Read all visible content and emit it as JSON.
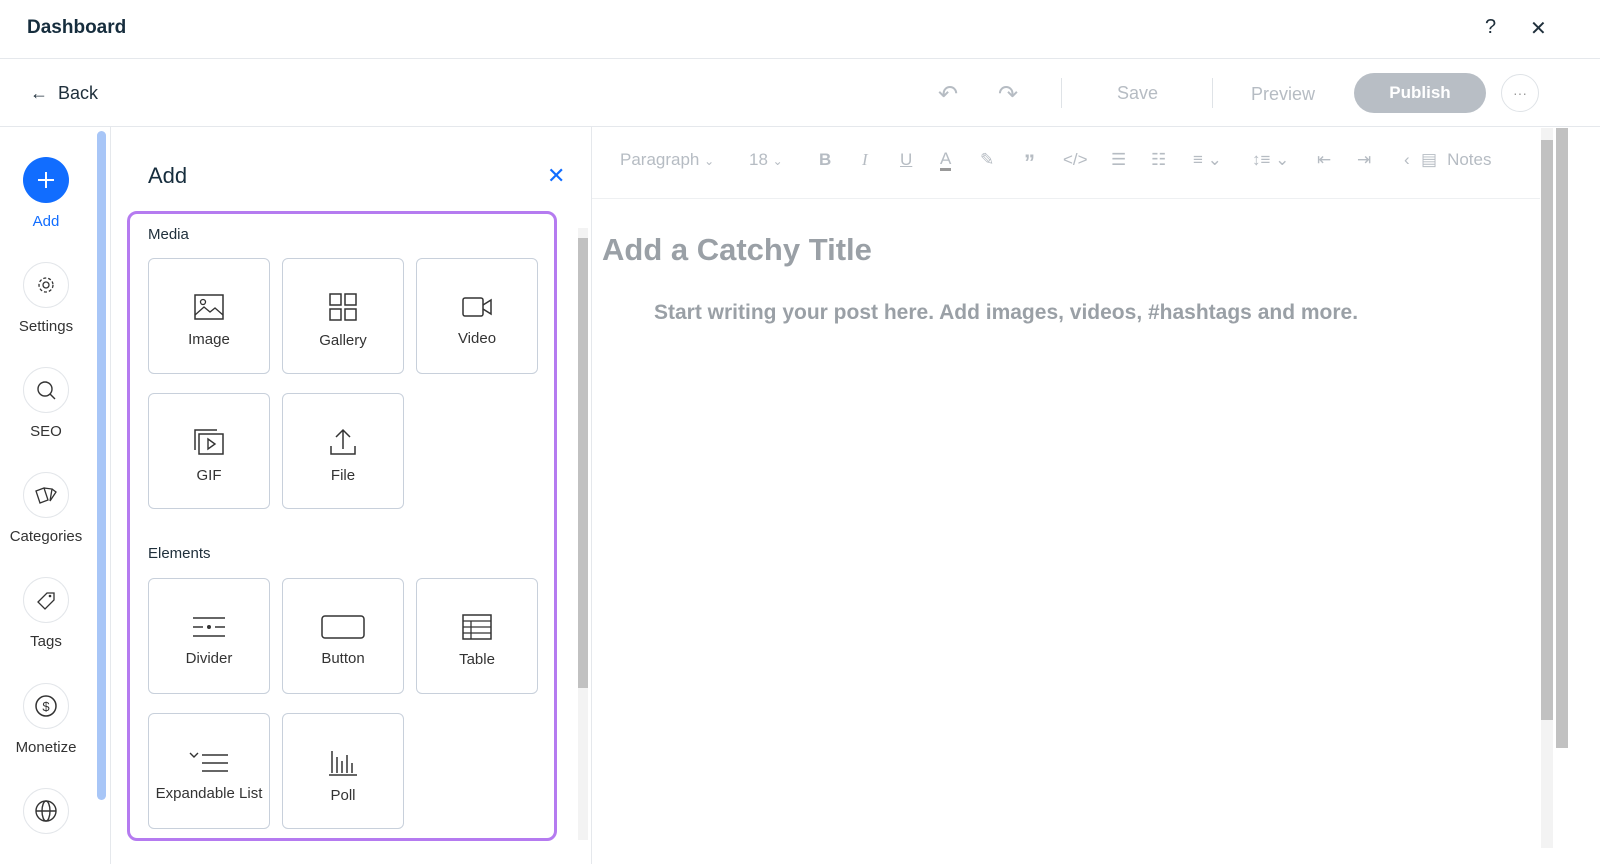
{
  "header": {
    "title": "Dashboard",
    "help": "?",
    "close": "✕"
  },
  "nav": {
    "back": "Back",
    "save": "Save",
    "preview": "Preview",
    "publish": "Publish",
    "more": "···"
  },
  "sidebar": {
    "items": [
      {
        "label": "Add",
        "icon": "plus-icon"
      },
      {
        "label": "Settings",
        "icon": "gear-icon"
      },
      {
        "label": "SEO",
        "icon": "search-icon"
      },
      {
        "label": "Categories",
        "icon": "categories-icon"
      },
      {
        "label": "Tags",
        "icon": "tag-icon"
      },
      {
        "label": "Monetize",
        "icon": "dollar-icon"
      },
      {
        "label": "",
        "icon": "globe-icon"
      }
    ]
  },
  "panel": {
    "title": "Add",
    "media_heading": "Media",
    "elements_heading": "Elements",
    "media": [
      "Image",
      "Gallery",
      "Video",
      "GIF",
      "File"
    ],
    "elements": [
      "Divider",
      "Button",
      "Table",
      "Expandable List",
      "Poll"
    ]
  },
  "toolbar": {
    "paragraph": "Paragraph",
    "font_size": "18",
    "notes": "Notes"
  },
  "editor": {
    "title_placeholder": "Add a Catchy Title",
    "body_placeholder": "Start writing your post here. Add images, videos, #hashtags and more."
  },
  "colors": {
    "accent": "#116dff",
    "highlight": "#b57bf0",
    "publish": "#b8bec5"
  }
}
